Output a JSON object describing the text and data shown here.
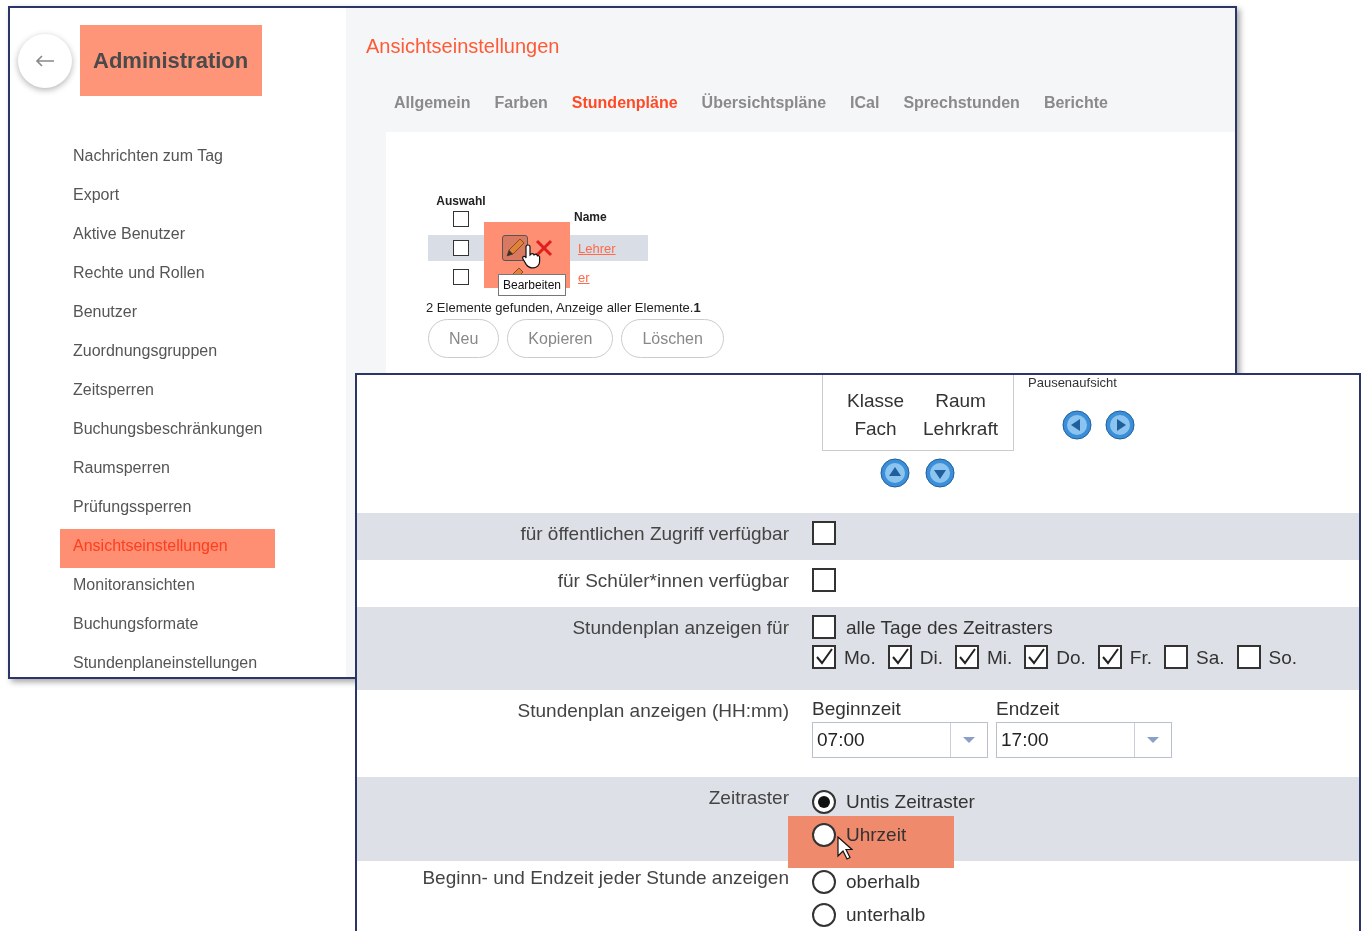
{
  "back_window": {
    "sidebar": {
      "title": "Administration",
      "items": [
        {
          "label": "Nachrichten zum Tag",
          "selected": false
        },
        {
          "label": "Export",
          "selected": false
        },
        {
          "label": "Aktive Benutzer",
          "selected": false
        },
        {
          "label": "Rechte und Rollen",
          "selected": false
        },
        {
          "label": "Benutzer",
          "selected": false
        },
        {
          "label": "Zuordnungsgruppen",
          "selected": false
        },
        {
          "label": "Zeitsperren",
          "selected": false
        },
        {
          "label": "Buchungsbeschränkungen",
          "selected": false
        },
        {
          "label": "Raumsperren",
          "selected": false
        },
        {
          "label": "Prüfungssperren",
          "selected": false
        },
        {
          "label": "Ansichtseinstellungen",
          "selected": true
        },
        {
          "label": "Monitoransichten",
          "selected": false
        },
        {
          "label": "Buchungsformate",
          "selected": false
        },
        {
          "label": "Stundenplaneinstellungen",
          "selected": false
        }
      ]
    },
    "page_title": "Ansichtseinstellungen",
    "tabs": [
      {
        "label": "Allgemein",
        "selected": false
      },
      {
        "label": "Farben",
        "selected": false
      },
      {
        "label": "Stundenpläne",
        "selected": true
      },
      {
        "label": "Übersichtspläne",
        "selected": false
      },
      {
        "label": "ICal",
        "selected": false
      },
      {
        "label": "Sprechstunden",
        "selected": false
      },
      {
        "label": "Berichte",
        "selected": false
      }
    ],
    "table": {
      "columns": [
        "Auswahl",
        "Name"
      ],
      "header_checked": false,
      "rows": [
        {
          "checked": false,
          "hovered": true,
          "highlighted": true,
          "edit_icon": true,
          "delete_icon": true,
          "name": "Lehrer"
        },
        {
          "checked": false,
          "hovered": false,
          "highlighted": false,
          "edit_icon": true,
          "delete_icon": false,
          "name": "er"
        }
      ]
    },
    "tooltip": "Bearbeiten",
    "summary": {
      "text": "2 Elemente gefunden, Anzeige aller Elemente.",
      "page": "1"
    },
    "buttons": [
      "Neu",
      "Kopieren",
      "Löschen"
    ]
  },
  "front_window": {
    "field_box": [
      "Klasse",
      "Raum",
      "Fach",
      "Lehrkraft"
    ],
    "side_label": "Pausenaufsicht",
    "rows": [
      {
        "kind": "checkbox",
        "label": "für öffentlichen Zugriff verfügbar",
        "checked": false
      },
      {
        "kind": "checkbox",
        "label": "für Schüler*innen verfügbar",
        "checked": false
      },
      {
        "kind": "days",
        "label": "Stundenplan anzeigen für",
        "all": {
          "label": "alle Tage des Zeitrasters",
          "checked": false
        },
        "days": [
          {
            "label": "Mo.",
            "checked": true
          },
          {
            "label": "Di.",
            "checked": true
          },
          {
            "label": "Mi.",
            "checked": true
          },
          {
            "label": "Do.",
            "checked": true
          },
          {
            "label": "Fr.",
            "checked": true
          },
          {
            "label": "Sa.",
            "checked": false
          },
          {
            "label": "So.",
            "checked": false
          }
        ]
      },
      {
        "kind": "times",
        "label": "Stundenplan anzeigen (HH:mm)",
        "fields": [
          {
            "label": "Beginnzeit",
            "value": "07:00"
          },
          {
            "label": "Endzeit",
            "value": "17:00"
          }
        ]
      },
      {
        "kind": "radio",
        "label": "Zeitraster",
        "options": [
          {
            "label": "Untis Zeitraster",
            "selected": true,
            "highlighted": false
          },
          {
            "label": "Uhrzeit",
            "selected": false,
            "highlighted": true
          }
        ]
      },
      {
        "kind": "radio",
        "label": "Beginn- und Endzeit jeder Stunde anzeigen",
        "options": [
          {
            "label": "oberhalb",
            "selected": false,
            "highlighted": false
          },
          {
            "label": "unterhalb",
            "selected": false,
            "highlighted": false
          }
        ]
      }
    ]
  }
}
